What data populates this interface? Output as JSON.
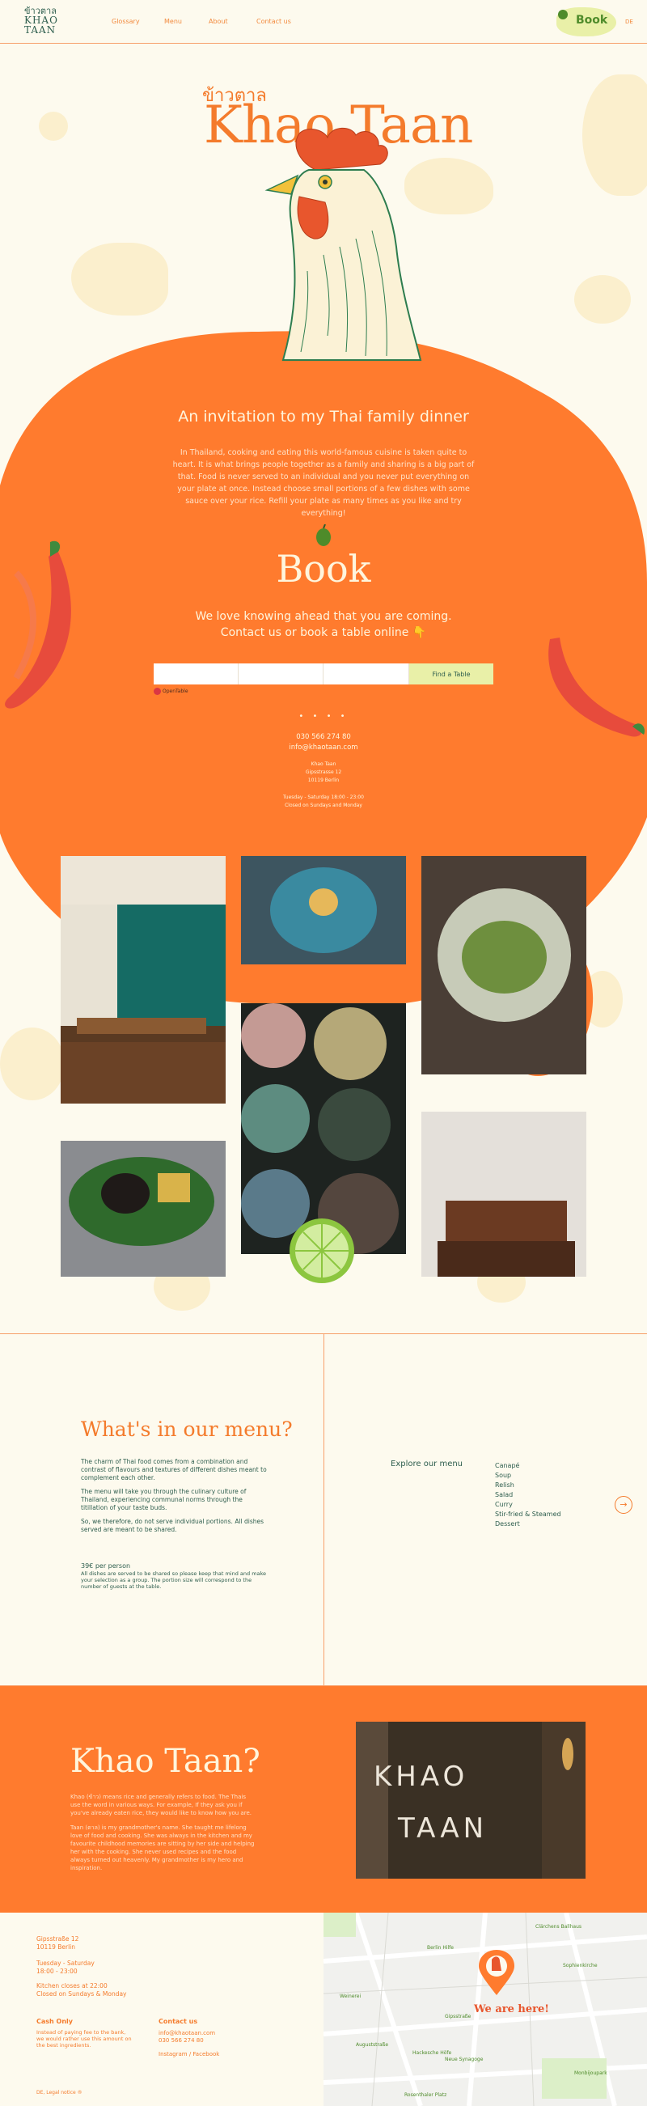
{
  "header": {
    "logo_thai": "ข้าวตาล",
    "logo_line1": "KHAO",
    "logo_line2": "TAAN",
    "nav": [
      "Glossary",
      "Menu",
      "About",
      "Contact us"
    ],
    "book_label": "Book",
    "lang": "DE"
  },
  "hero": {
    "thai": "ข้าวตาล",
    "title": "Khao Taan"
  },
  "invitation": {
    "title": "An invitation to my Thai family dinner",
    "text": "In Thailand, cooking and eating this world-famous cuisine is taken quite to heart. It is what brings people together as a family and sharing is a big part of that. Food is never served to an individual and you never put everything on your plate at once. Instead choose small portions of a few dishes with some sauce over your rice. Refill your plate as many times as you like and try everything!"
  },
  "booking": {
    "title": "Book",
    "line1": "We love knowing ahead that you are coming.",
    "line2": "Contact us or book a table online 👇",
    "button": "Find a Table",
    "powered": "OpenTable",
    "dots": "• • • •",
    "phone": "030 566 274 80",
    "email": "info@khaotaan.com",
    "addr1": "Khao Taan",
    "addr2": "Gipsstrasse 12",
    "addr3": "10119 Berlin",
    "hours1": "Tuesday - Saturday 18:00 - 23:00",
    "hours2": "Closed on Sundays and Monday"
  },
  "menu": {
    "title": "What's in our menu?",
    "p1": "The charm of Thai food comes from a combination and contrast of flavours and textures of different dishes meant to complement each other.",
    "p2": "The menu will take you through the culinary culture of Thailand, experiencing communal norms through the titillation of your taste buds.",
    "p3": "So, we therefore, do not serve individual portions. All dishes served are meant to be shared.",
    "price": "39€ per person",
    "price_note": "All dishes are served to be shared so please keep that mind and make your selection as a group. The portion size will correspond to the number of guests at the table.",
    "explore": "Explore our menu",
    "items": [
      "Canapé",
      "Soup",
      "Relish",
      "Salad",
      "Curry",
      "Stir-fried & Steamed",
      "Dessert"
    ],
    "arrow": "→"
  },
  "about": {
    "title": "Khao Taan?",
    "p1": "Khao (ข้าว) means rice and generally refers to food. The Thais use the word in various ways. For example, If they ask you if you've already eaten rice, they would like to know how you are.",
    "p2": "Taan (ตาล) is my grandmother's name. She taught me lifelong love of food and cooking. She was always in the kitchen and my favourite childhood memories are sitting by her side and helping her with the cooking. She never used recipes and the food always turned out heavenly. My grandmother is my hero and inspiration.",
    "sign_line1": "KHAO",
    "sign_line2": "TAAN"
  },
  "footer": {
    "addr1": "Gipsstraße 12",
    "addr2": "10119 Berlin",
    "days": "Tuesday - Saturday",
    "time": "18:00 - 23:00",
    "kitchen": "Kitchen closes at 22:00",
    "closed": "Closed on Sundays & Monday",
    "cash_label": "Cash Only",
    "cash_text": "Instead of paying fee to the bank, we would rather use this amount on the best ingredients.",
    "contact_label": "Contact us",
    "contact_email": "info@khaotaan.com",
    "contact_phone": "030 566 274 80",
    "social": "Instagram / Facebook",
    "legal": "DE, Legal notice ®",
    "map_label": "We are here!",
    "map_places": [
      "Berlin Hilfe",
      "Clärchens Ballhaus",
      "Sophienkirche",
      "Weinerei",
      "Gipsstraße",
      "Auguststraße",
      "Hackesche Höfe",
      "Neue Synagoge",
      "Monbijoupark",
      "Rosenthaler Platz"
    ]
  },
  "colors": {
    "orange": "#FF7B2E",
    "cream": "#FDFAEE",
    "green": "#2E5E4E",
    "lime": "#E9F0A8"
  }
}
